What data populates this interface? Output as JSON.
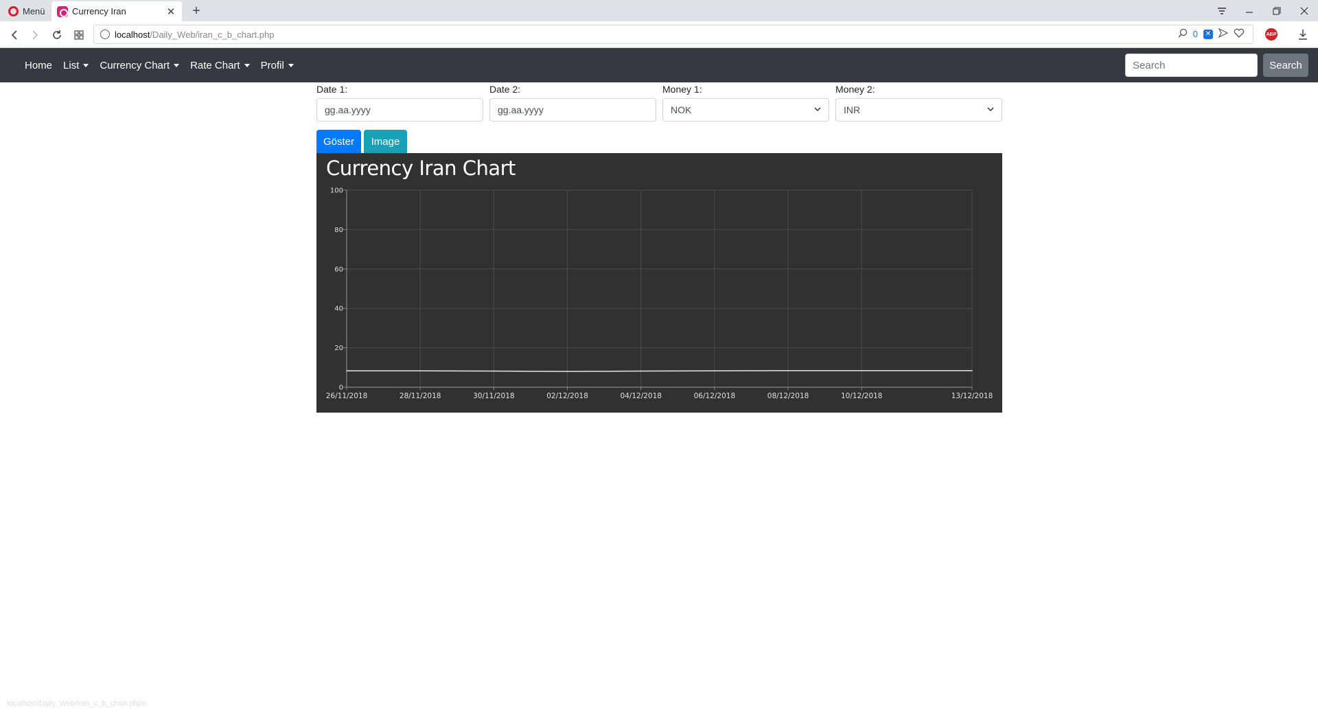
{
  "browser": {
    "menu_label": "Menü",
    "tab_title": "Currency Iran",
    "new_tab_symbol": "+",
    "url_host": "localhost",
    "url_path": "/Daily_Web/iran_c_b_chart.php",
    "shield_count": "0",
    "abp_label": "ABP"
  },
  "navbar": {
    "items": [
      {
        "label": "Home",
        "dropdown": false
      },
      {
        "label": "List",
        "dropdown": true
      },
      {
        "label": "Currency Chart",
        "dropdown": true
      },
      {
        "label": "Rate Chart",
        "dropdown": true
      },
      {
        "label": "Profil",
        "dropdown": true
      }
    ],
    "search_placeholder": "Search",
    "search_button": "Search"
  },
  "form": {
    "date1": {
      "label": "Date 1:",
      "placeholder": "gg.aa.yyyy"
    },
    "date2": {
      "label": "Date 2:",
      "placeholder": "gg.aa.yyyy"
    },
    "money1": {
      "label": "Money 1:",
      "value": "NOK"
    },
    "money2": {
      "label": "Money 2:",
      "value": "INR"
    },
    "show_button": "Göster",
    "image_button": "Image"
  },
  "colors": {
    "navbar_bg": "#343a40",
    "chart_bg": "#313131",
    "primary": "#007bff",
    "info": "#17a2b8",
    "line": "#e6e6e6"
  },
  "chart_data": {
    "type": "line",
    "title": "Currency Iran Chart",
    "xlabel": "",
    "ylabel": "",
    "ylim": [
      0,
      100
    ],
    "yticks": [
      0,
      20,
      40,
      60,
      80,
      100
    ],
    "xlim": [
      "26/11/2018",
      "13/12/2018"
    ],
    "xticks": [
      "26/11/2018",
      "28/11/2018",
      "30/11/2018",
      "02/12/2018",
      "04/12/2018",
      "06/12/2018",
      "08/12/2018",
      "10/12/2018",
      "13/12/2018"
    ],
    "grid": true,
    "legend": "none",
    "series": [
      {
        "x": [
          "26/11/2018",
          "28/11/2018",
          "30/11/2018",
          "02/12/2018",
          "04/12/2018",
          "06/12/2018",
          "08/12/2018",
          "10/12/2018",
          "13/12/2018"
        ],
        "values": [
          8.3,
          8.3,
          8.2,
          8.0,
          8.2,
          8.3,
          8.4,
          8.4,
          8.4
        ]
      }
    ]
  },
  "status_url": "localhost/Daily_Web/iran_c_b_chart.php#"
}
